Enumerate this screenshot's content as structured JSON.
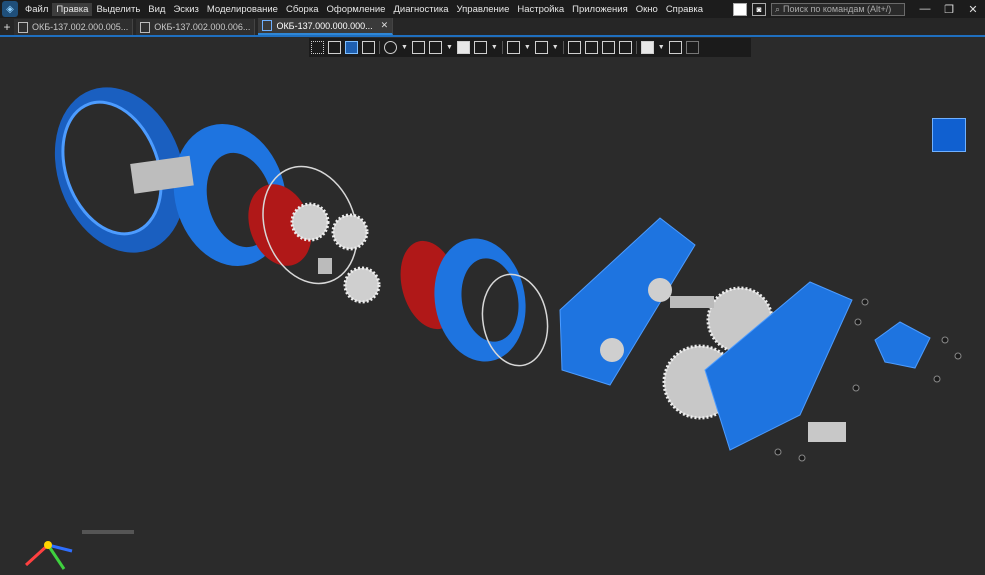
{
  "menu": [
    "Файл",
    "Правка",
    "Выделить",
    "Вид",
    "Эскиз",
    "Моделирование",
    "Сборка",
    "Оформление",
    "Диагностика",
    "Управление",
    "Настройка",
    "Приложения",
    "Окно",
    "Справка"
  ],
  "menu_active_index": 1,
  "search": {
    "placeholder": "Поиск по командам (Alt+/)"
  },
  "window_controls": {
    "minimize": "—",
    "restore": "❐",
    "close": "✕"
  },
  "tabs": [
    {
      "label": "ОКБ-137.002.000.005...",
      "active": false
    },
    {
      "label": "ОКБ-137.002.000.006...",
      "active": false
    },
    {
      "label": "ОКБ-137.000.000.000...",
      "active": true
    }
  ],
  "tab_add": "+",
  "tab_close": "✕",
  "colors": {
    "part_blue": "#1e74e0",
    "part_red": "#b01818",
    "metal": "#c8c8c8",
    "accent": "#1f6fbf"
  }
}
